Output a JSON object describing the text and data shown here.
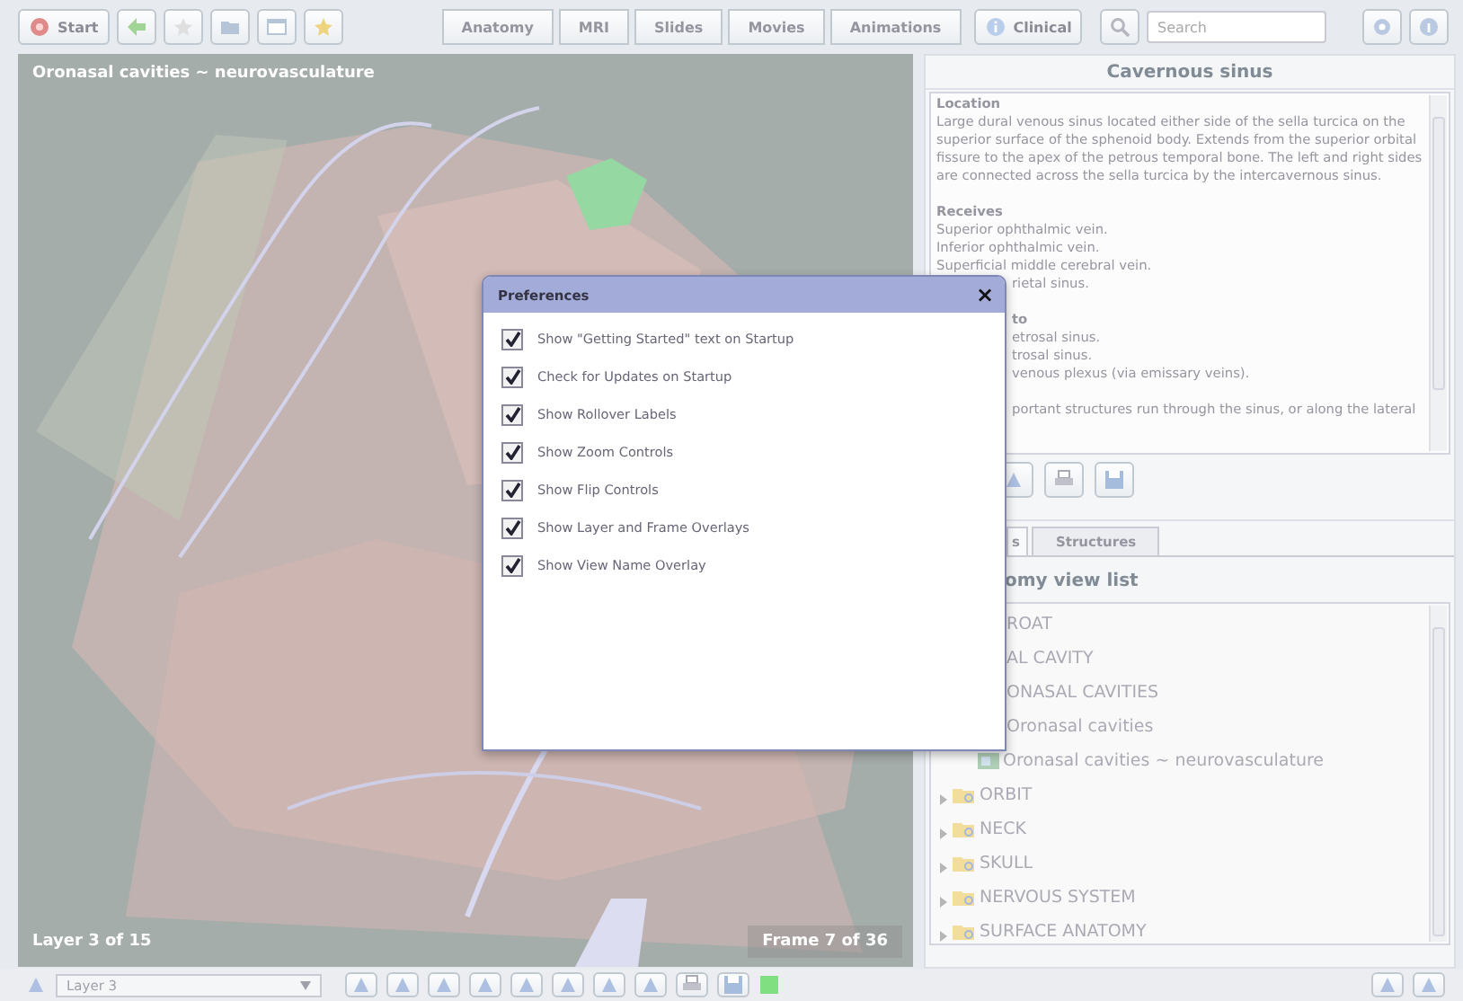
{
  "toolbar": {
    "start": "Start",
    "tabs": [
      {
        "label": "Anatomy",
        "selected": false
      },
      {
        "label": "MRI",
        "selected": false
      },
      {
        "label": "Slides",
        "selected": false
      },
      {
        "label": "Movies",
        "selected": false
      },
      {
        "label": "Animations",
        "selected": false
      }
    ],
    "clinical": "Clinical",
    "search": {
      "placeholder": "Search"
    }
  },
  "viewer": {
    "view_name": "Oronasal cavities ~ neurovasculature",
    "layer": "Layer 3 of 15",
    "frame": "Frame 7 of 36"
  },
  "info": {
    "title": "Cavernous sinus",
    "lines": [
      {
        "kind": "heading",
        "text": "Location"
      },
      {
        "kind": "text",
        "text": "Large dural venous sinus located either side of the sella turcica on the superior surface of the sphenoid body. Extends from the superior orbital fissure to the apex of the petrous temporal bone. The left and right sides are connected across the sella turcica by the intercavernous sinus."
      },
      {
        "kind": "gap"
      },
      {
        "kind": "heading",
        "text": "Receives"
      },
      {
        "kind": "text",
        "text": "Superior ophthalmic vein."
      },
      {
        "kind": "text",
        "text": "Inferior ophthalmic vein."
      },
      {
        "kind": "text",
        "text": "Superficial middle cerebral vein."
      },
      {
        "kind": "cut",
        "text": "rietal sinus."
      },
      {
        "kind": "gap"
      },
      {
        "kind": "cut-heading",
        "text": "to"
      },
      {
        "kind": "cut",
        "text": "etrosal sinus."
      },
      {
        "kind": "cut",
        "text": "trosal sinus."
      },
      {
        "kind": "cut",
        "text": "venous plexus (via emissary veins)."
      },
      {
        "kind": "gap"
      },
      {
        "kind": "cut",
        "text": "portant structures run through the sinus, or along the lateral"
      }
    ]
  },
  "lower": {
    "tabs": [
      {
        "label": "s",
        "selected": true
      },
      {
        "label": "Structures",
        "selected": false
      }
    ],
    "heading": "omy view list",
    "tree": [
      {
        "label": "ROAT",
        "kind": "cut",
        "children": [
          {
            "label": "AL CAVITY",
            "kind": "cut",
            "children": [
              {
                "label": "ONASAL CAVITIES",
                "kind": "cut",
                "children": [
                  {
                    "label": "Oronasal cavities",
                    "kind": "cut"
                  },
                  {
                    "label": "Oronasal cavities ~ neurovasculature",
                    "kind": "view"
                  }
                ]
              }
            ]
          }
        ]
      },
      {
        "label": "ORBIT",
        "kind": "folder",
        "expanded": false
      },
      {
        "label": "NECK",
        "kind": "folder",
        "expanded": false
      },
      {
        "label": "SKULL",
        "kind": "folder",
        "expanded": false
      },
      {
        "label": "NERVOUS SYSTEM",
        "kind": "folder",
        "expanded": false
      },
      {
        "label": "SURFACE ANATOMY",
        "kind": "folder",
        "expanded": false
      }
    ]
  },
  "bottom_bar": {
    "layer_select": "Layer 3"
  },
  "preferences": {
    "title": "Preferences",
    "close": "×",
    "options": [
      {
        "label": "Show \"Getting Started\" text on Startup",
        "checked": true
      },
      {
        "label": "Check for Updates on Startup",
        "checked": true
      },
      {
        "label": "Show Rollover Labels",
        "checked": true
      },
      {
        "label": "Show Zoom Controls",
        "checked": true
      },
      {
        "label": "Show Flip Controls",
        "checked": true
      },
      {
        "label": "Show Layer and Frame Overlays",
        "checked": true
      },
      {
        "label": "Show View Name Overlay",
        "checked": true
      }
    ]
  }
}
